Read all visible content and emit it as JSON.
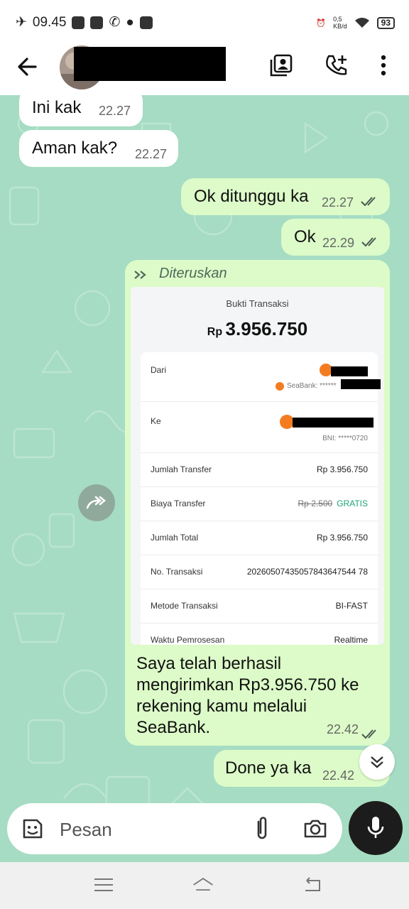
{
  "status_bar": {
    "time": "09.45",
    "net_speed": "0,5",
    "net_unit": "KB/d",
    "battery": "93"
  },
  "chat": {
    "messages": [
      {
        "text": "Ini kak",
        "time": "22.27"
      },
      {
        "text": "Aman kak?",
        "time": "22.27"
      },
      {
        "text": "Ok ditunggu ka",
        "time": "22.27"
      },
      {
        "text": "Ok",
        "time": "22.29"
      }
    ],
    "forwarded": {
      "label": "Diteruskan",
      "receipt": {
        "title": "Bukti Transaksi",
        "currency": "Rp",
        "amount": "3.956.750",
        "from_label": "Dari",
        "from_bank": "SeaBank: ******",
        "to_label": "Ke",
        "to_bank": "BNI: *****0720",
        "rows": [
          {
            "label": "Jumlah Transfer",
            "value": "Rp 3.956.750"
          },
          {
            "label": "Biaya Transfer",
            "strike": "Rp 2.500",
            "value": "GRATIS"
          },
          {
            "label": "Jumlah Total",
            "value": "Rp 3.956.750"
          },
          {
            "label": "No. Transaksi",
            "value": "20260507435057843647544 78"
          },
          {
            "label": "Metode Transaksi",
            "value": "BI-FAST"
          },
          {
            "label": "Waktu Pemrosesan",
            "value": "Realtime"
          }
        ]
      },
      "message": "Saya telah berhasil mengirimkan Rp3.956.750 ke rekening kamu melalui SeaBank.",
      "time": "22.42"
    },
    "last": {
      "text": "Done ya ka",
      "time": "22.42"
    }
  },
  "composer": {
    "placeholder": "Pesan"
  },
  "colors": {
    "chat_bg": "#a6dcc3",
    "outgoing": "#dcfbc8",
    "incoming": "#ffffff",
    "accent": "#1aa37a"
  }
}
